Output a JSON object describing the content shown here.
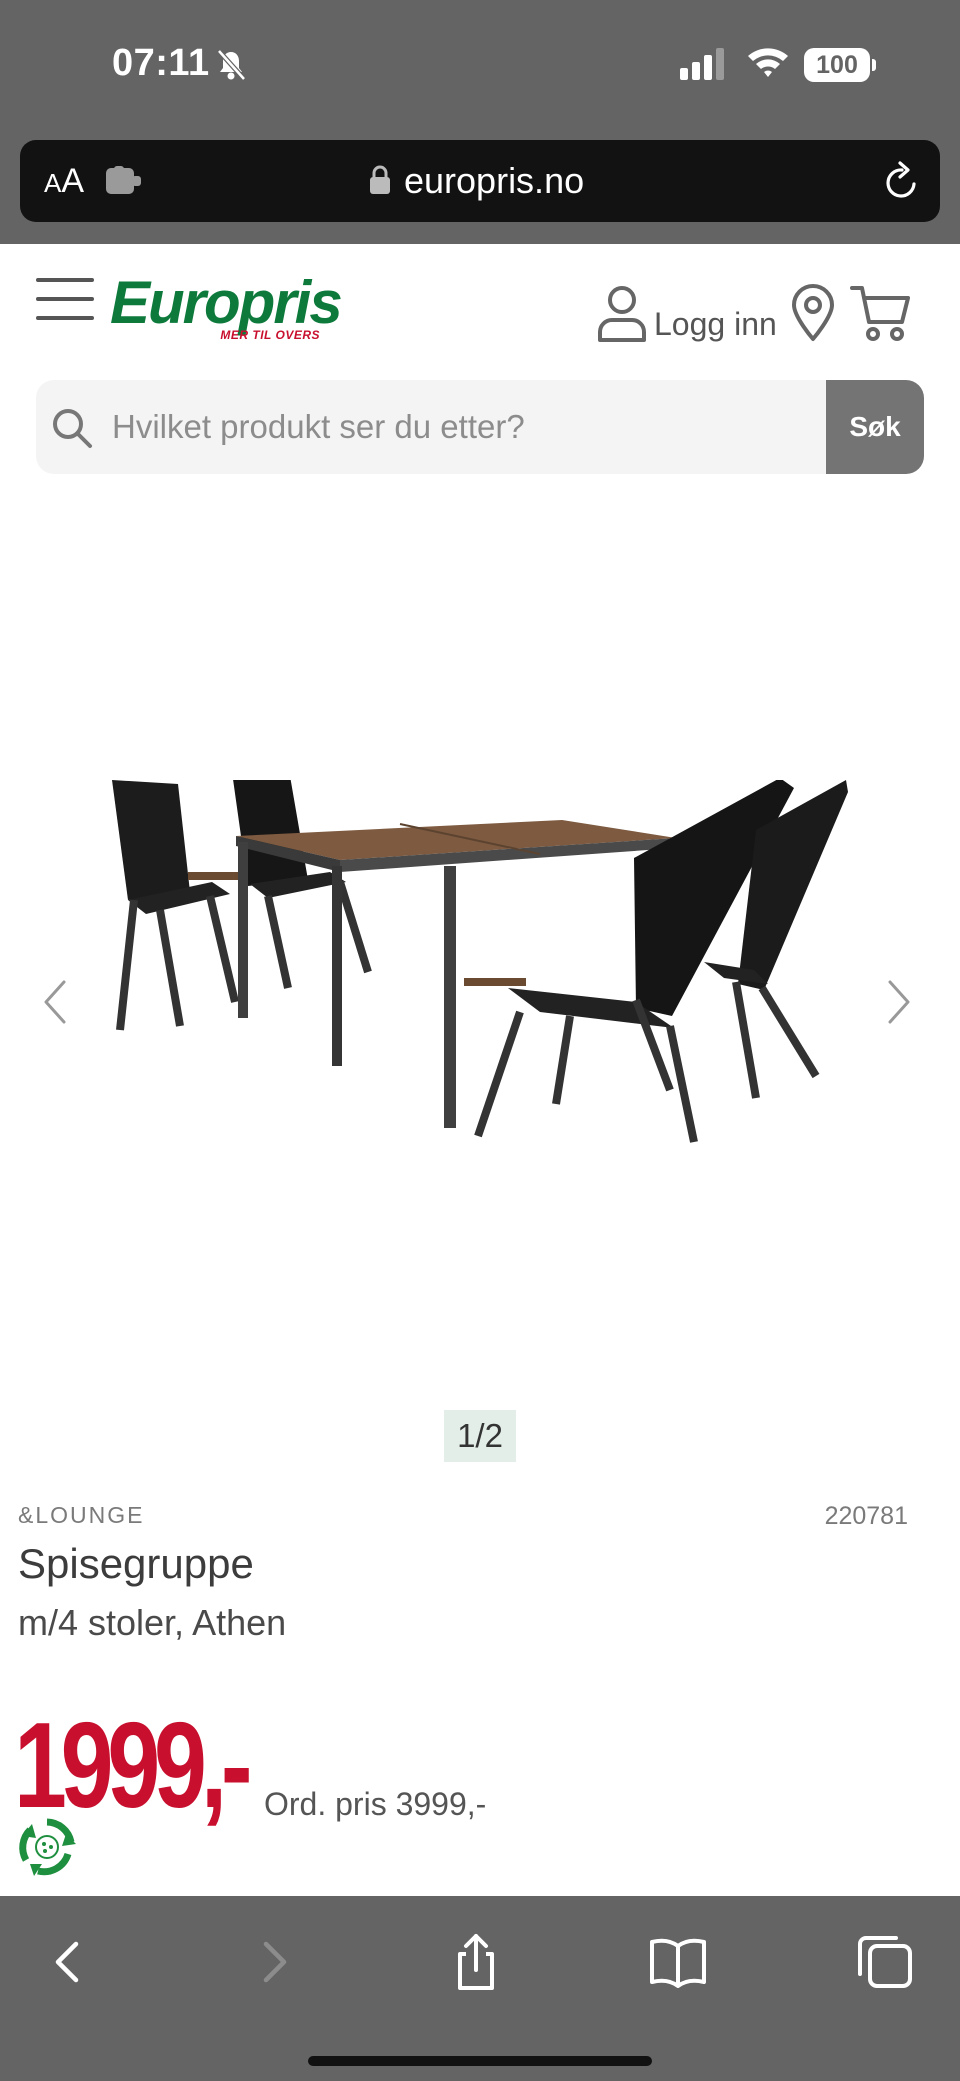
{
  "status_bar": {
    "time": "07:11",
    "battery": "100",
    "icons": [
      "bell-slash-icon",
      "signal-icon",
      "wifi-icon",
      "battery-icon"
    ]
  },
  "browser": {
    "aa_label_small": "A",
    "aa_label_large": "A",
    "url": "europris.no",
    "icons": [
      "extension-icon",
      "lock-icon",
      "reload-icon"
    ]
  },
  "header": {
    "logo_text": "Europris",
    "logo_tagline": "MER TIL OVERS",
    "login_label": "Logg inn",
    "icons": [
      "hamburger-menu-icon",
      "user-icon",
      "location-pin-icon",
      "cart-icon"
    ]
  },
  "search": {
    "placeholder": "Hvilket produkt ser du etter?",
    "button_label": "Søk"
  },
  "carousel": {
    "counter": "1/2"
  },
  "product": {
    "brand": "&LOUNGE",
    "sku": "220781",
    "title": "Spisegruppe",
    "subtitle": "m/4 stoler, Athen",
    "price": "1999,-",
    "ordinary_price": "Ord. pris 3999,-"
  },
  "colors": {
    "brand_green": "#0d7a3c",
    "price_red": "#c8102e",
    "chrome_gray": "#646464",
    "counter_bg": "#e2eee7"
  }
}
